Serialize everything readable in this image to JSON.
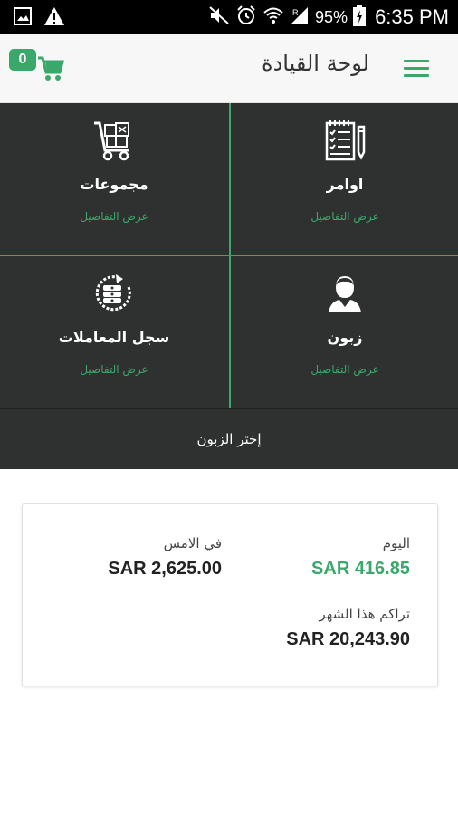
{
  "status_bar": {
    "battery_percent": "95%",
    "time": "6:35 PM",
    "icons": [
      "image-notification-icon",
      "warning-icon",
      "mute-icon",
      "alarm-icon",
      "wifi-icon",
      "signal-icon",
      "battery-icon"
    ]
  },
  "app_bar": {
    "title": "لوحة القيادة",
    "cart_count": "0"
  },
  "tiles": [
    {
      "id": "orders",
      "label": "اوامر",
      "link": "عرض التفاصيل",
      "icon": "notepad-icon"
    },
    {
      "id": "collections",
      "label": "مجموعات",
      "link": "عرض التفاصيل",
      "icon": "hand-truck-icon"
    },
    {
      "id": "customer",
      "label": "زبون",
      "link": "عرض التفاصيل",
      "icon": "person-icon"
    },
    {
      "id": "transactions",
      "label": "سجل المعاملات",
      "link": "عرض التفاصيل",
      "icon": "money-refresh-icon"
    }
  ],
  "choose_customer": "إختر الزبون",
  "summary": {
    "today_label": "اليوم",
    "today_value": "SAR 416.85",
    "yesterday_label": "في الامس",
    "yesterday_value": "SAR 2,625.00",
    "month_label": "تراكم هذا الشهر",
    "month_value": "SAR 20,243.90"
  },
  "colors": {
    "accent": "#3aa86b",
    "tile_bg": "#2f3030",
    "status_bar": "#000000"
  }
}
